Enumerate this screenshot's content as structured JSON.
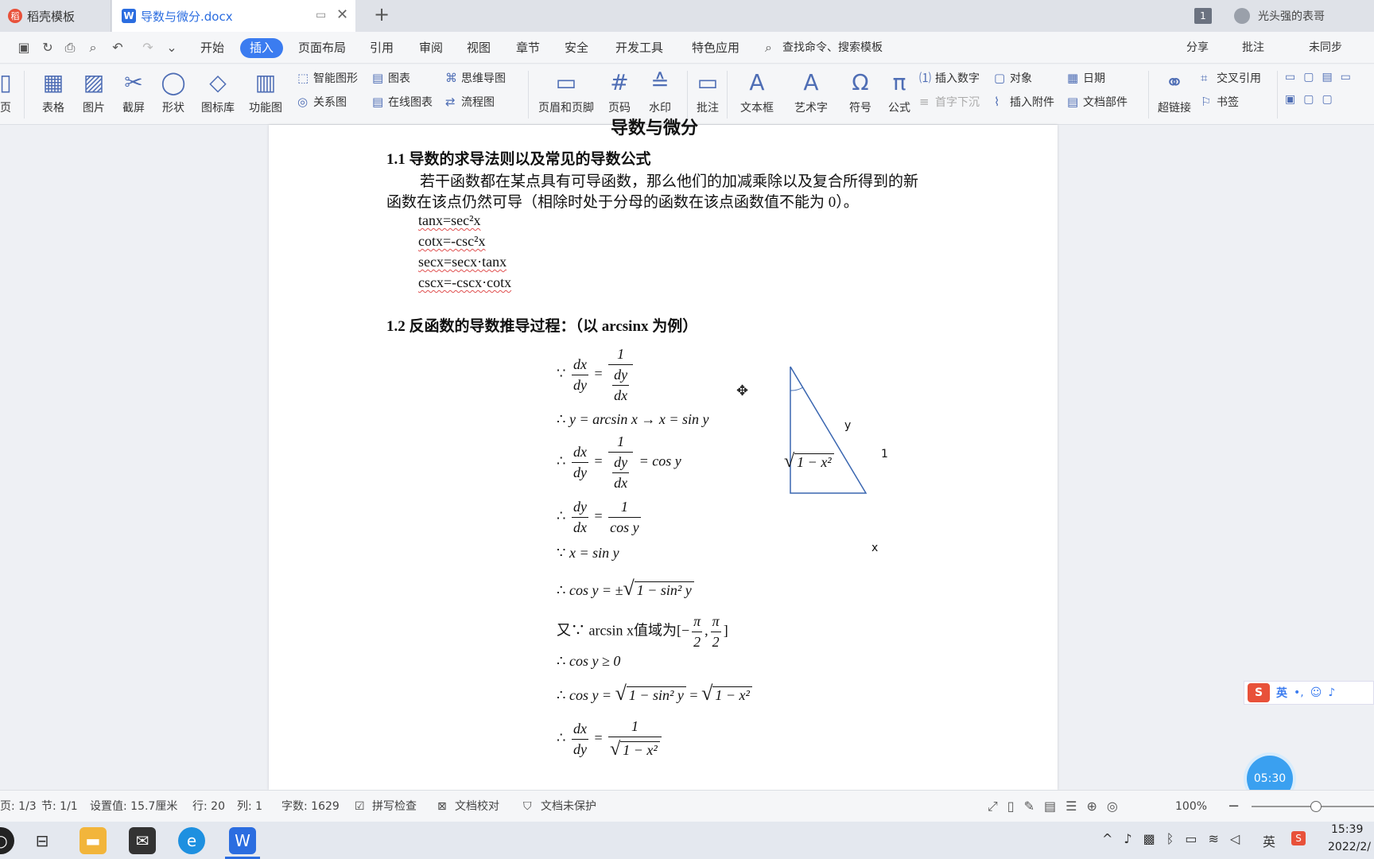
{
  "tabs": {
    "tab1": "稻壳模板",
    "tab2": "导数与微分.docx",
    "new_tab": "+",
    "badge": "1",
    "user": "光头强的表哥"
  },
  "menu": {
    "items": [
      "开始",
      "插入",
      "页面布局",
      "引用",
      "审阅",
      "视图",
      "章节",
      "安全",
      "开发工具",
      "特色应用"
    ],
    "search": "查找命令、搜索模板",
    "share": "分享",
    "comment": "批注",
    "sync": "未同步"
  },
  "ribbon": {
    "page": "页",
    "table": "表格",
    "picture": "图片",
    "screenshot": "截屏",
    "shape": "形状",
    "iconlib": "图标库",
    "funcimg": "功能图",
    "smartshape": "智能图形",
    "chart": "图表",
    "mindmap": "思维导图",
    "relation": "关系图",
    "onlinechart": "在线图表",
    "flowchart": "流程图",
    "headerfooter": "页眉和页脚",
    "pagenum": "页码",
    "watermark": "水印",
    "comment": "批注",
    "textbox": "文本框",
    "wordart": "艺术字",
    "symbol": "符号",
    "formula": "公式",
    "insertnum": "插入数字",
    "object": "对象",
    "date": "日期",
    "dropcap": "首字下沉",
    "attach": "插入附件",
    "docpart": "文档部件",
    "hyperlink": "超链接",
    "crossref": "交叉引用",
    "bookmark": "书签"
  },
  "doc": {
    "title": "导数与微分",
    "h1": "1.1  导数的求导法则以及常见的导数公式",
    "p1a": "若干函数都在某点具有可导函数，那么他们的加减乘除以及复合所得到的新",
    "p1b": "函数在该点仍然可导（相除时处于分母的函数在该点函数值不能为 0）。",
    "f1": "tanx=sec²x",
    "f2": "cotx=-csc²x",
    "f3": "secx=secx·tanx",
    "f4": "cscx=-cscx·cotx",
    "h2": "1.2  反函数的导数推导过程：（以 arcsinx 为例）",
    "eq": {
      "because": "∵",
      "therefore": "∴",
      "you": "又∵",
      "dx": "dx",
      "dy": "dy",
      "one": "1",
      "eq": "=",
      "e2": "y = arcsin x → x = sin y",
      "cosy": "= cos y",
      "cosy_den": "cos y",
      "e5": "x = sin y",
      "e6a": "cos y = ±",
      "e6b": "1 − sin² y",
      "e7a": "arcsin x值域为[−",
      ",": ",",
      "close": "]",
      "pi": "π",
      "two": "2",
      "e8": "cos y ≥ 0",
      "e9a": "cos y =",
      "e9b": "1 − sin² y",
      "e9c": "=",
      "e9d": "1 − x²",
      "e10d": "1 − x²"
    },
    "tri": {
      "angle": "y",
      "hyp": "1",
      "side": "1 − x²",
      "base": "x"
    }
  },
  "status": {
    "page": "页: 1/3",
    "section": "节: 1/1",
    "setting": "设置值: 15.7厘米",
    "row": "行: 20",
    "col": "列: 1",
    "words": "字数: 1629",
    "spell": "拼写检查",
    "proof": "文档校对",
    "protect": "文档未保护",
    "zoom": "100%",
    "timer": "05:30",
    "ime": "英"
  },
  "taskbar": {
    "time": "15:39",
    "date": "2022/2/"
  }
}
